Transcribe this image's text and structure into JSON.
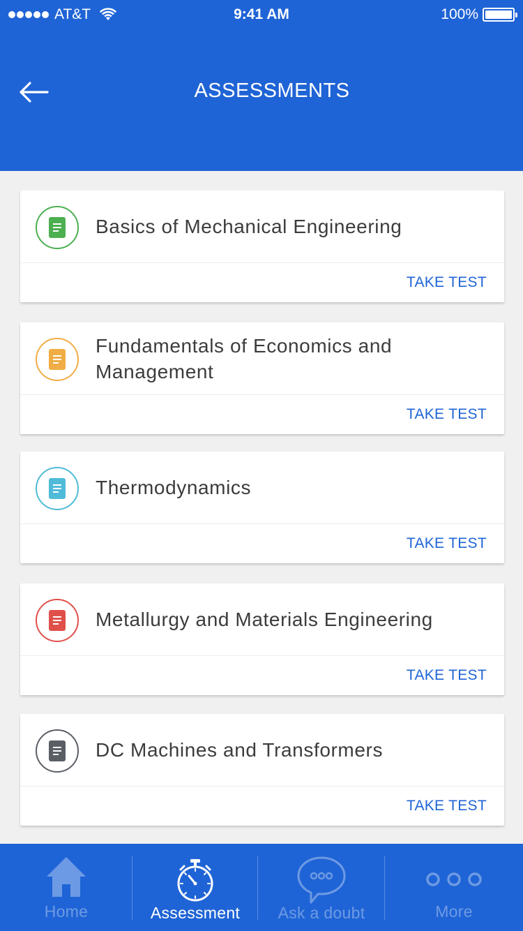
{
  "status_bar": {
    "carrier": "AT&T",
    "time": "9:41 AM",
    "battery": "100%"
  },
  "header": {
    "title": "ASSESSMENTS"
  },
  "courses": [
    {
      "title": "Basics of Mechanical Engineering",
      "action": "TAKE TEST",
      "color": "#4caf50"
    },
    {
      "title": "Fundamentals of Economics and Management",
      "action": "TAKE TEST",
      "color": "#f0ad45"
    },
    {
      "title": "Thermodynamics",
      "action": "TAKE TEST",
      "color": "#4fbbd8"
    },
    {
      "title": "Metallurgy and Materials Engineering",
      "action": "TAKE TEST",
      "color": "#e0504a"
    },
    {
      "title": "DC Machines and Transformers",
      "action": "TAKE TEST",
      "color": "#5a5f66"
    }
  ],
  "tabbar": {
    "tabs": [
      {
        "label": "Home",
        "icon": "home-icon"
      },
      {
        "label": "Assessment",
        "icon": "stopwatch-icon",
        "active": true
      },
      {
        "label": "Ask a doubt",
        "icon": "chat-bubble-icon"
      },
      {
        "label": "More",
        "icon": "more-dots-icon"
      }
    ]
  },
  "colors": {
    "primary": "#1f64d6",
    "background": "#f0f0f0"
  }
}
